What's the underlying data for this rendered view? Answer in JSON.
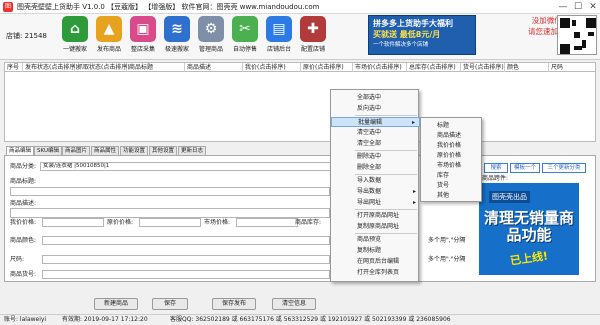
{
  "window": {
    "title": "图壳壳壁壁上货助手 V1.0.0 【豆蔻版】 【增强版】  软件官网：图壳壳 www.miandoudou.com",
    "icon": "app-logo",
    "controls": [
      "—",
      "☐",
      "✕"
    ]
  },
  "shop": {
    "label": "店铺:",
    "value": "21548"
  },
  "toolbar": [
    {
      "label": "一键搬家",
      "icon": "house-cart-icon",
      "color": "#2e9b3a",
      "glyph": "⌂"
    },
    {
      "label": "发布商品",
      "icon": "publish-icon",
      "color": "#e7a21e",
      "glyph": "▲"
    },
    {
      "label": "整店采集",
      "icon": "collect-icon",
      "color": "#d84a8a",
      "glyph": "▣"
    },
    {
      "label": "极速搬家",
      "icon": "layers-icon",
      "color": "#2f6fcf",
      "glyph": "≋"
    },
    {
      "label": "管理商品",
      "icon": "gear-icon",
      "color": "#7f8fa8",
      "glyph": "⚙"
    },
    {
      "label": "自动停售",
      "icon": "scissors-icon",
      "color": "#4caf50",
      "glyph": "✂"
    },
    {
      "label": "店铺后台",
      "icon": "monitor-icon",
      "color": "#2c7be5",
      "glyph": "▤"
    },
    {
      "label": "配置店铺",
      "icon": "toolbox-icon",
      "color": "#b33a3a",
      "glyph": "✚"
    }
  ],
  "ads": {
    "banner": {
      "line1": "拼多多上货助手大福利",
      "line2": "买就送 最低8元/月",
      "line3": "一个软件解决多个店铺"
    },
    "wechat": {
      "line1": "没加微信的亲",
      "line2": "请您速加微信！"
    }
  },
  "table": {
    "headers": [
      "序号",
      "发布状态(点击排序)",
      "抓取状态(点击排序)",
      "商品标题",
      "商品描述",
      "我价(点击排序)",
      "原价(点击排序)",
      "市场价(点击排序)",
      "总库存(点击排序)",
      "货号(点击排序)",
      "颜色",
      "尺码"
    ]
  },
  "context_menu": {
    "items": [
      "全部选中",
      "反向选中",
      "批量编辑",
      "清空选中",
      "清空全部",
      "删除选中",
      "删除全部",
      "导入数据",
      "导出数据",
      "导出网址",
      "打开原商品网址",
      "复制原商品网址",
      "商品预览",
      "复制标题",
      "在网页后台编辑",
      "打开全库列表页"
    ],
    "highlighted": "批量编辑",
    "has_submenu": [
      "批量编辑",
      "导出数据",
      "导出网址"
    ]
  },
  "submenu": {
    "items": [
      "标题",
      "商品描述",
      "我价价格",
      "原价价格",
      "市场价格",
      "库存",
      "货号",
      "其他"
    ]
  },
  "tabs": {
    "items": [
      "商品编辑",
      "SKU编辑",
      "商品图片",
      "商品属性",
      "功能设置",
      "其他设置",
      "更新日志"
    ],
    "active": "商品编辑"
  },
  "form": {
    "category_label": "商品分类:",
    "category_value": "女装/连衣裙 |50010850|1",
    "title_label": "商品标题:",
    "desc_label": "商品描述:",
    "price_label": "我价价格:",
    "orig_label": "原价价格:",
    "market_label": "市场价格:",
    "stock_label": "商品库存:",
    "color_label": "商品颜色:",
    "size_label": "尺码:",
    "sku_label": "商品货号:",
    "multi_hint_1": "多个用\",\"分隔",
    "multi_hint_2": "多个用\",\"分隔",
    "side_buttons": [
      "搜索",
      "模板一个",
      "三个更新分类"
    ],
    "side_label": "商品跨件:"
  },
  "promo": {
    "tag": "图壳壳出品",
    "main": "清理无销量商品功能",
    "sub": "已上线!"
  },
  "buttons": {
    "new": "新建商品",
    "save": "保存",
    "save_publish": "保存发布",
    "clear": "清空信息"
  },
  "status": {
    "account": "账号: lalaweiyi",
    "expiry": "有效期: 2019-09-17 17:12:20",
    "qq": "客服QQ: 362502189 或 663175176 或 563312529 或 192101927 或 502193399 或 236085906"
  }
}
